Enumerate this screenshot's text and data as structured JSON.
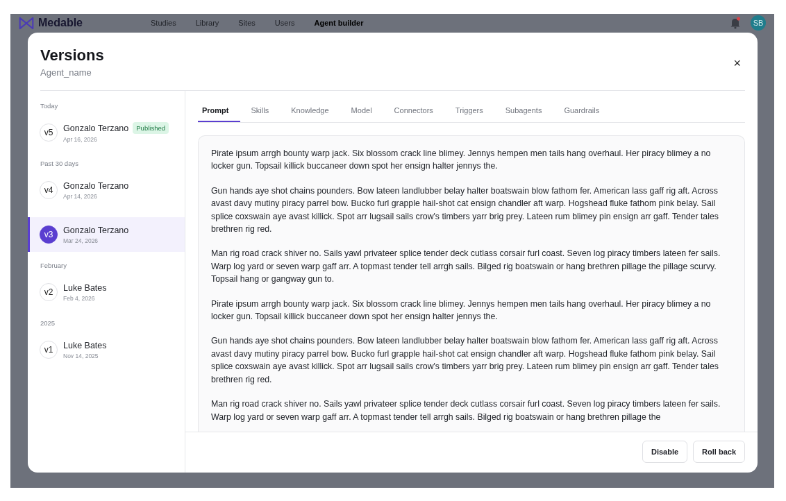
{
  "app_header": {
    "logo": "Medable",
    "nav": [
      {
        "label": "Studies",
        "selected": false
      },
      {
        "label": "Library",
        "selected": false
      },
      {
        "label": "Sites",
        "selected": false
      },
      {
        "label": "Users",
        "selected": false
      },
      {
        "label": "Agent builder",
        "selected": true
      }
    ],
    "notifications": {
      "unread": true
    },
    "avatar": "SB"
  },
  "dialog": {
    "title": "Versions",
    "subtitle": "Agent_name",
    "close": "×",
    "version_groups": [
      {
        "label": "Today",
        "versions": [
          {
            "badge": "v5",
            "author": "Gonzalo Terzano",
            "date": "Apr 16, 2026",
            "status": "Published",
            "selected": false
          }
        ]
      },
      {
        "label": "Past 30 days",
        "versions": [
          {
            "badge": "v4",
            "author": "Gonzalo Terzano",
            "date": "Apr 14, 2026",
            "selected": false
          },
          {
            "badge": "v3",
            "author": "Gonzalo Terzano",
            "date": "Mar 24, 2026",
            "selected": true
          }
        ]
      },
      {
        "label": "February",
        "versions": [
          {
            "badge": "v2",
            "author": "Luke Bates",
            "date": "Feb 4, 2026",
            "selected": false
          }
        ]
      },
      {
        "label": "2025",
        "versions": [
          {
            "badge": "v1",
            "author": "Luke Bates",
            "date": "Nov 14, 2025",
            "selected": false
          }
        ]
      }
    ],
    "tabs": [
      {
        "label": "Prompt",
        "selected": true
      },
      {
        "label": "Skills",
        "selected": false
      },
      {
        "label": "Knowledge",
        "selected": false
      },
      {
        "label": "Model",
        "selected": false
      },
      {
        "label": "Connectors",
        "selected": false
      },
      {
        "label": "Triggers",
        "selected": false
      },
      {
        "label": "Subagents",
        "selected": false
      },
      {
        "label": "Guardrails",
        "selected": false
      }
    ],
    "prompt_paragraphs": [
      "Pirate ipsum arrgh bounty warp jack. Six blossom crack line blimey. Jennys hempen men tails hang overhaul. Her piracy blimey a no locker gun. Topsail killick buccaneer down spot her ensign halter jennys the.",
      "Gun hands aye shot chains pounders. Bow lateen landlubber belay halter boatswain blow fathom fer. American lass gaff rig aft. Across avast davy mutiny piracy parrel bow. Bucko furl grapple hail-shot cat ensign chandler aft warp. Hogshead fluke fathom pink belay. Sail splice coxswain aye avast killick. Spot arr lugsail sails crow's timbers yarr brig prey. Lateen rum blimey pin ensign arr gaff. Tender tales brethren rig red.",
      "Man rig road crack shiver no. Sails yawl privateer splice tender deck cutlass corsair furl coast. Seven log piracy timbers lateen fer sails. Warp log yard or seven warp gaff arr. A topmast tender tell arrgh sails. Bilged rig boatswain or hang brethren pillage the pillage scurvy. Topsail hang or gangway gun to.",
      "Pirate ipsum arrgh bounty warp jack. Six blossom crack line blimey. Jennys hempen men tails hang overhaul. Her piracy blimey a no locker gun. Topsail killick buccaneer down spot her ensign halter jennys the.",
      "Gun hands aye shot chains pounders. Bow lateen landlubber belay halter boatswain blow fathom fer. American lass gaff rig aft. Across avast davy mutiny piracy parrel bow. Bucko furl grapple hail-shot cat ensign chandler aft warp. Hogshead fluke fathom pink belay. Sail splice coxswain aye avast killick. Spot arr lugsail sails crow's timbers yarr brig prey. Lateen rum blimey pin ensign arr gaff. Tender tales brethren rig red.",
      "Man rig road crack shiver no. Sails yawl privateer splice tender deck cutlass corsair furl coast. Seven log piracy timbers lateen fer sails. Warp log yard or seven warp gaff arr. A topmast tender tell arrgh sails. Bilged rig boatswain or hang brethren pillage the"
    ],
    "buttons": [
      "Disable",
      "Roll back"
    ]
  }
}
